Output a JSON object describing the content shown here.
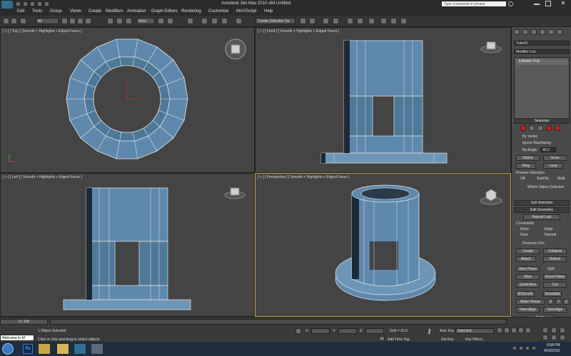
{
  "window": {
    "title": "Autodesk 3ds Max 2010 x64",
    "doc_title": "Untitled",
    "search_placeholder": "Type a keyword or phrase"
  },
  "menu": [
    "Edit",
    "Tools",
    "Group",
    "Views",
    "Create",
    "Modifiers",
    "Animation",
    "Graph Editors",
    "Rendering",
    "Customize",
    "MAXScript",
    "Help"
  ],
  "toolbar": {
    "selection_filter": "All",
    "view_dropdown": "View",
    "named_selection": "Create Selection Se"
  },
  "viewports": {
    "top": "[ + ] [ Top ] [ Smooth + Highlights + Edged Faces ]",
    "front": "[ + ] [ Front ] [ Smooth + Highlights + Edged Faces ]",
    "left": "[ + ] [ Left ] [ Smooth + Highlights + Edged Faces ]",
    "perspective": "[ + ] [ Perspective ] [ Smooth + Highlights + Edged Faces ]"
  },
  "command_panel": {
    "object_name": "Tube01",
    "modifier_list": "Modifier List",
    "stack_item": "Editable Poly",
    "selection_header": "Selection",
    "by_vertex": "By Vertex",
    "ignore_backfacing": "Ignore Backfacing",
    "by_angle": "By Angle:",
    "angle_value": "45.0",
    "shrink": "Shrink",
    "grow": "Grow",
    "ring": "Ring",
    "loop": "Loop",
    "preview_selection": "Preview Selection",
    "off": "Off",
    "subobj": "SubObj",
    "multi": "Multi",
    "whole_object": "Whole Object Selected",
    "soft_selection": "Soft Selection",
    "edit_geometry": "Edit Geometry",
    "repeat_last": "Repeat Last",
    "constraints": "Constraints",
    "none": "None",
    "edge": "Edge",
    "face": "Face",
    "normal": "Normal",
    "preserve_uvs": "Preserve UVs",
    "create": "Create",
    "collapse": "Collapse",
    "attach": "Attach",
    "detach": "Detach",
    "slice_plane": "Slice Plane",
    "split": "Split",
    "slice": "Slice",
    "reset_plane": "Reset Plane",
    "quickslice": "QuickSlice",
    "cut": "Cut",
    "msmooth": "MSmooth",
    "tessellate": "Tessellate",
    "make_planar": "Make Planar",
    "x": "X",
    "y": "Y",
    "z": "Z",
    "view_align": "View Align",
    "grid_align": "Grid Align",
    "relax": "Relax"
  },
  "status": {
    "time_slider": "0 / 100",
    "maxscript_listener": "Welcome to M",
    "selected_count": "1 Object Selected",
    "prompt": "Click or click-and-drag to select objects",
    "x_label": "X:",
    "y_label": "Y:",
    "z_label": "Z:",
    "grid": "Grid = 10.0",
    "add_time_tag": "Add Time Tag",
    "auto_key": "Auto Key",
    "set_key": "Set Key",
    "key_mode": "Selected",
    "key_filters": "Key Filters..."
  },
  "taskbar": {
    "time": "6:58 PM",
    "date": "4/16/2010",
    "ps_label": "Ps"
  },
  "colors": {
    "model_blue": "#5e89ad",
    "viewport_bg": "#444444",
    "active_border": "#c8a540",
    "taskbar": "#1f2d3f"
  }
}
